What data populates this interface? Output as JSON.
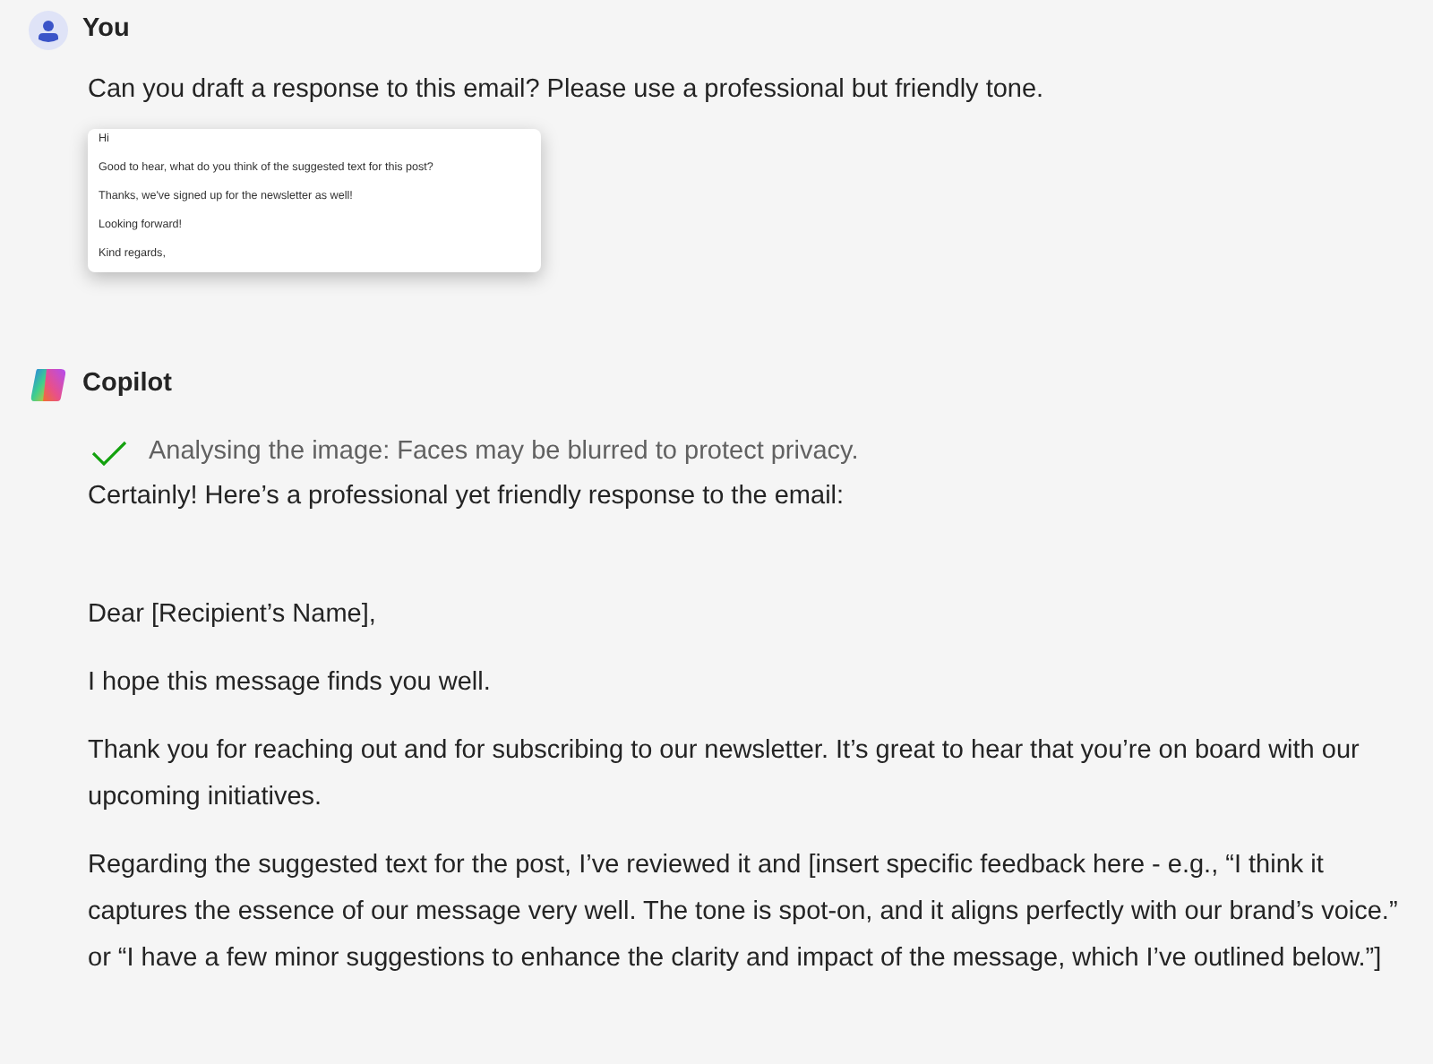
{
  "messages": [
    {
      "kind": "user",
      "author": "You",
      "text": "Can you draft a response to this email? Please use a professional but friendly tone.",
      "attachment": {
        "lines": [
          "Hi",
          "Good to hear, what do you think of the suggested text for this post?",
          "Thanks, we've signed up for the newsletter as well!",
          "Looking forward!",
          "Kind regards,"
        ]
      }
    },
    {
      "kind": "assistant",
      "author": "Copilot",
      "status": {
        "done": true,
        "text": "Analysing the image: Faces may be blurred to protect privacy."
      },
      "paragraphs": [
        "Certainly! Here’s a professional yet friendly response to the email:",
        "Dear [Recipient’s Name],",
        "I hope this message finds you well.",
        "Thank you for reaching out and for subscribing to our newsletter. It’s great to hear that you’re on board with our upcoming initiatives.",
        "Regarding the suggested text for the post, I’ve reviewed it and [insert specific feedback here - e.g., “I think it captures the essence of our message very well. The tone is spot-on, and it aligns perfectly with our brand’s voice.” or “I have a few minor suggestions to enhance the clarity and impact of the message, which I’ve outlined below.”]"
      ]
    }
  ]
}
